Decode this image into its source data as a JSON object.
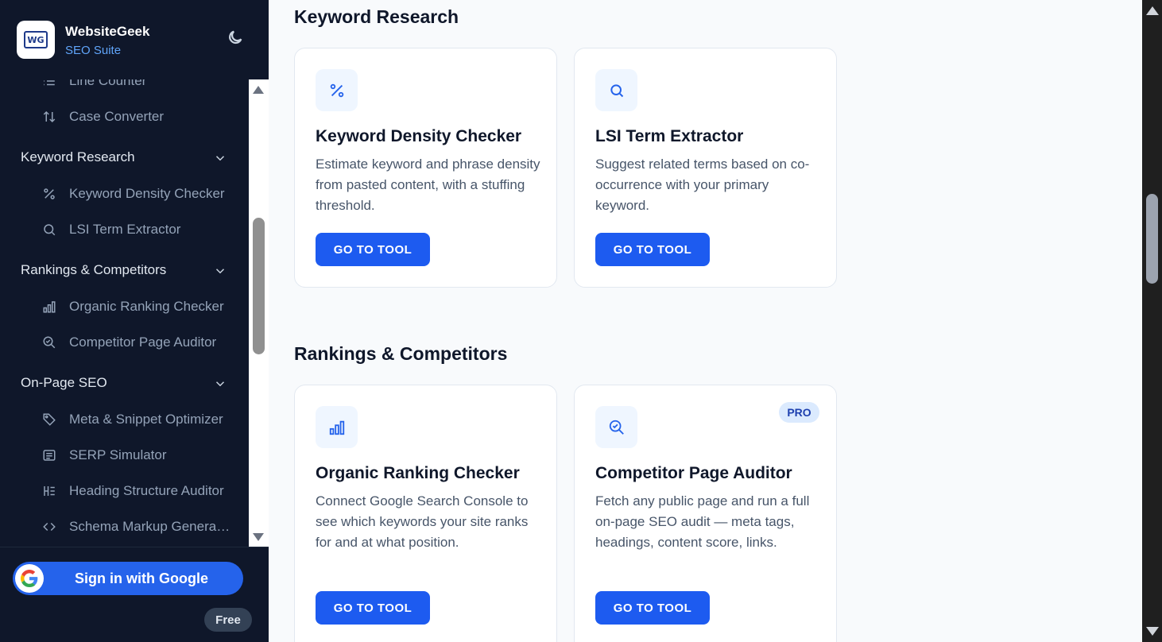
{
  "brand": {
    "name": "WebsiteGeek",
    "subtitle": "SEO Suite",
    "logo_text": "WG"
  },
  "sidebar": {
    "items": [
      {
        "type": "item",
        "label": "Line Counter",
        "icon": "list-icon"
      },
      {
        "type": "item",
        "label": "Case Converter",
        "icon": "arrows-updown-icon"
      },
      {
        "type": "group",
        "label": "Keyword Research",
        "icon": "chevron-down-icon"
      },
      {
        "type": "item",
        "label": "Keyword Density Checker",
        "icon": "percent-icon"
      },
      {
        "type": "item",
        "label": "LSI Term Extractor",
        "icon": "search-icon"
      },
      {
        "type": "group",
        "label": "Rankings & Competitors",
        "icon": "chevron-down-icon"
      },
      {
        "type": "item",
        "label": "Organic Ranking Checker",
        "icon": "bar-chart-icon"
      },
      {
        "type": "item",
        "label": "Competitor Page Auditor",
        "icon": "search-check-icon"
      },
      {
        "type": "group",
        "label": "On-Page SEO",
        "icon": "chevron-down-icon"
      },
      {
        "type": "item",
        "label": "Meta & Snippet Optimizer",
        "icon": "tag-icon"
      },
      {
        "type": "item",
        "label": "SERP Simulator",
        "icon": "document-icon"
      },
      {
        "type": "item",
        "label": "Heading Structure Auditor",
        "icon": "heading-icon"
      },
      {
        "type": "item",
        "label": "Schema Markup Generator",
        "icon": "code-icon"
      }
    ],
    "signin_label": "Sign in with Google",
    "plan_badge": "Free"
  },
  "sections": [
    {
      "title": "Keyword Research",
      "cards": [
        {
          "title": "Keyword Density Checker",
          "desc": "Estimate keyword and phrase density from pasted content, with a stuffing threshold.",
          "button": "GO TO TOOL",
          "icon": "percent-icon",
          "badge": ""
        },
        {
          "title": "LSI Term Extractor",
          "desc": "Suggest related terms based on co-occurrence with your primary keyword.",
          "button": "GO TO TOOL",
          "icon": "search-icon",
          "badge": ""
        }
      ]
    },
    {
      "title": "Rankings & Competitors",
      "cards": [
        {
          "title": "Organic Ranking Checker",
          "desc": "Connect Google Search Console to see which keywords your site ranks for and at what position.",
          "button": "GO TO TOOL",
          "icon": "bar-chart-icon",
          "badge": ""
        },
        {
          "title": "Competitor Page Auditor",
          "desc": "Fetch any public page and run a full on-page SEO audit — meta tags, headings, content score, links.",
          "button": "GO TO TOOL",
          "icon": "search-check-icon",
          "badge": "PRO"
        }
      ]
    }
  ],
  "colors": {
    "sidebar_bg": "#0f172a",
    "accent": "#1d5bf0",
    "brand_sub": "#60a5fa",
    "page_bg": "#f8fafc"
  }
}
